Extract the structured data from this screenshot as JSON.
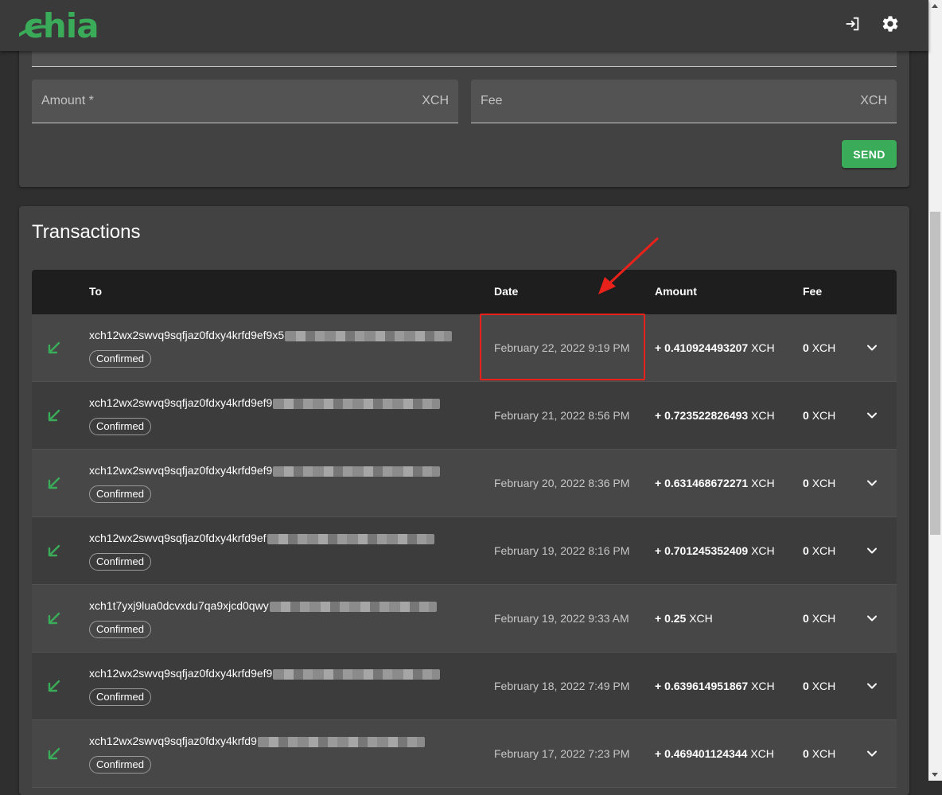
{
  "header": {
    "logo_text": "chia",
    "brand_color": "#3aac59",
    "logout_icon": "logout-icon",
    "settings_icon": "gear-icon"
  },
  "send_form": {
    "amount_label": "Amount *",
    "amount_unit": "XCH",
    "fee_label": "Fee",
    "fee_unit": "XCH",
    "send_label": "SEND"
  },
  "transactions": {
    "title": "Transactions",
    "columns": {
      "to": "To",
      "date": "Date",
      "amount": "Amount",
      "fee": "Fee"
    },
    "rows": [
      {
        "address": "xch12wx2swvq9sqfjaz0fdxy4krfd9ef9x5",
        "status": "Confirmed",
        "date": "February 22, 2022 9:19 PM",
        "sign": "+",
        "amount": "0.410924493207",
        "unit": "XCH",
        "fee": "0",
        "fee_unit": "XCH"
      },
      {
        "address": "xch12wx2swvq9sqfjaz0fdxy4krfd9ef9",
        "status": "Confirmed",
        "date": "February 21, 2022 8:56 PM",
        "sign": "+",
        "amount": "0.723522826493",
        "unit": "XCH",
        "fee": "0",
        "fee_unit": "XCH"
      },
      {
        "address": "xch12wx2swvq9sqfjaz0fdxy4krfd9ef9",
        "status": "Confirmed",
        "date": "February 20, 2022 8:36 PM",
        "sign": "+",
        "amount": "0.631468672271",
        "unit": "XCH",
        "fee": "0",
        "fee_unit": "XCH"
      },
      {
        "address": "xch12wx2swvq9sqfjaz0fdxy4krfd9ef",
        "status": "Confirmed",
        "date": "February 19, 2022 8:16 PM",
        "sign": "+",
        "amount": "0.701245352409",
        "unit": "XCH",
        "fee": "0",
        "fee_unit": "XCH"
      },
      {
        "address": "xch1t7yxj9lua0dcvxdu7qa9xjcd0qwy",
        "status": "Confirmed",
        "date": "February 19, 2022 9:33 AM",
        "sign": "+",
        "amount": "0.25",
        "unit": "XCH",
        "fee": "0",
        "fee_unit": "XCH"
      },
      {
        "address": "xch12wx2swvq9sqfjaz0fdxy4krfd9ef9",
        "status": "Confirmed",
        "date": "February 18, 2022 7:49 PM",
        "sign": "+",
        "amount": "0.639614951867",
        "unit": "XCH",
        "fee": "0",
        "fee_unit": "XCH"
      },
      {
        "address": "xch12wx2swvq9sqfjaz0fdxy4krfd9",
        "status": "Confirmed",
        "date": "February 17, 2022 7:23 PM",
        "sign": "+",
        "amount": "0.469401124344",
        "unit": "XCH",
        "fee": "0",
        "fee_unit": "XCH"
      }
    ]
  }
}
